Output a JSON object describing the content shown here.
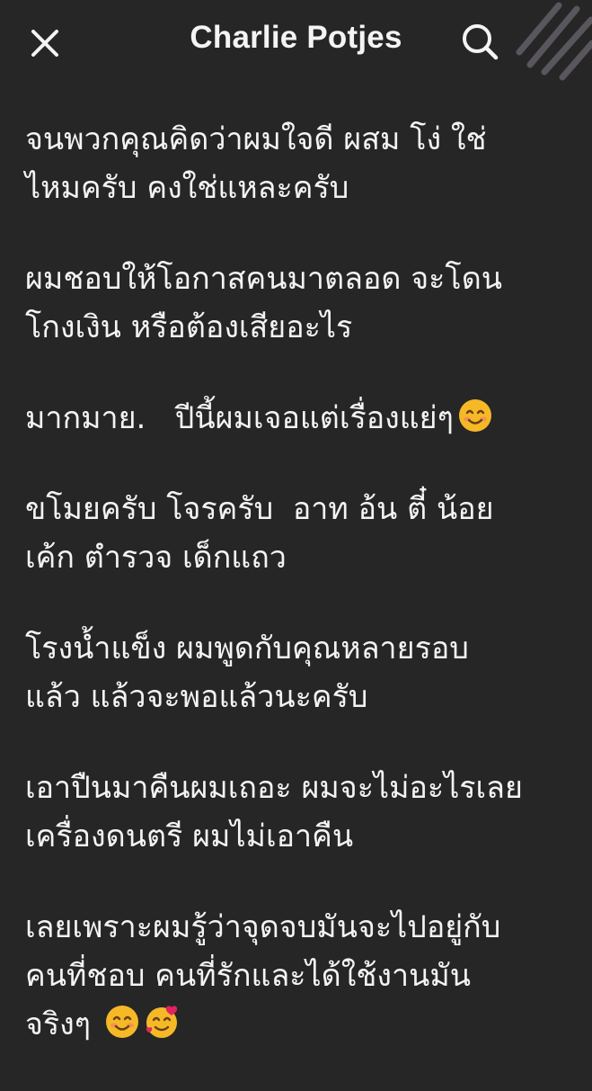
{
  "header": {
    "title": "Charlie Potjes",
    "close_icon": "close-icon",
    "search_icon": "search-icon"
  },
  "paragraphs": [
    {
      "lines": [
        "จนพวกคุณคิดว่าผมใจดี ผสม โง่ ใช่",
        "ไหมครับ คงใช่แหละครับ"
      ]
    },
    {
      "lines": [
        "ผมชอบให้โอกาสคนมาตลอด จะโดน",
        "โกงเงิน หรือต้องเสียอะไร"
      ]
    },
    {
      "lines": [
        "มากมาย.   ปีนี้ผมเจอแต่เรื่องแย่ๆ"
      ],
      "emoji": "smiling-face-icon"
    },
    {
      "lines": [
        "ขโมยครับ โจรครับ  อาท อ้น ตี๋ น้อย",
        "เค้ก ตำรวจ เด็กแถว"
      ]
    },
    {
      "lines": [
        "โรงน้ำแข็ง ผมพูดกับคุณหลายรอบ",
        "แล้ว แล้วจะพอแล้วนะครับ"
      ]
    },
    {
      "lines": [
        "เอาปืนมาคืนผมเถอะ ผมจะไม่อะไรเลย",
        "เครื่องดนตรี ผมไม่เอาคืน"
      ]
    },
    {
      "lines": [
        "เลยเพราะผมรู้ว่าจุดจบมันจะไปอยู่กับ",
        "คนที่ชอบ คนที่รักและได้ใช้งานมัน",
        "จริงๆ"
      ],
      "emoji_tail": [
        "smiling-face-icon",
        "smiling-face-with-hearts-icon"
      ]
    }
  ],
  "colors": {
    "background": "#262626",
    "text": "#f3f3f3",
    "emoji_face": "#f5b928"
  }
}
